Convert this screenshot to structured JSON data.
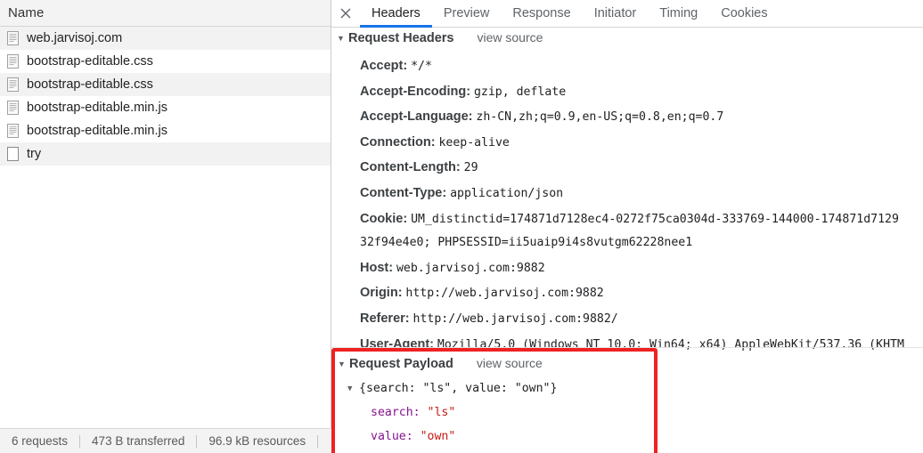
{
  "left_panel": {
    "column_header": "Name",
    "requests": [
      {
        "name": "web.jarvisoj.com",
        "icon": "document-icon"
      },
      {
        "name": "bootstrap-editable.css",
        "icon": "document-icon"
      },
      {
        "name": "bootstrap-editable.css",
        "icon": "document-icon"
      },
      {
        "name": "bootstrap-editable.min.js",
        "icon": "document-icon"
      },
      {
        "name": "bootstrap-editable.min.js",
        "icon": "document-icon"
      },
      {
        "name": "try",
        "icon": "blank-document-icon"
      }
    ],
    "status_bar": {
      "requests": "6 requests",
      "transferred": "473 B transferred",
      "resources": "96.9 kB resources"
    }
  },
  "right_panel": {
    "close_icon": "close-icon",
    "tabs": [
      {
        "label": "Headers",
        "active": true
      },
      {
        "label": "Preview",
        "active": false
      },
      {
        "label": "Response",
        "active": false
      },
      {
        "label": "Initiator",
        "active": false
      },
      {
        "label": "Timing",
        "active": false
      },
      {
        "label": "Cookies",
        "active": false
      }
    ],
    "request_headers": {
      "title": "Request Headers",
      "view_source": "view source",
      "twisty": "▼",
      "items": [
        {
          "name": "Accept:",
          "value": "*/*"
        },
        {
          "name": "Accept-Encoding:",
          "value": "gzip, deflate"
        },
        {
          "name": "Accept-Language:",
          "value": "zh-CN,zh;q=0.9,en-US;q=0.8,en;q=0.7"
        },
        {
          "name": "Connection:",
          "value": "keep-alive"
        },
        {
          "name": "Content-Length:",
          "value": "29"
        },
        {
          "name": "Content-Type:",
          "value": "application/json"
        },
        {
          "name": "Cookie:",
          "value": "UM_distinctid=174871d7128ec4-0272f75ca0304d-333769-144000-174871d7129"
        },
        {
          "name": "",
          "value": "32f94e4e0; PHPSESSID=ii5uaip9i4s8vutgm62228nee1",
          "continuation": true
        },
        {
          "name": "Host:",
          "value": "web.jarvisoj.com:9882"
        },
        {
          "name": "Origin:",
          "value": "http://web.jarvisoj.com:9882"
        },
        {
          "name": "Referer:",
          "value": "http://web.jarvisoj.com:9882/"
        },
        {
          "name": "User-Agent:",
          "value": "Mozilla/5.0 (Windows NT 10.0; Win64; x64) AppleWebKit/537.36 (KHTM"
        }
      ]
    },
    "request_payload": {
      "title": "Request Payload",
      "view_source": "view source",
      "twisty": "▼",
      "root_line": {
        "twisty": "▼",
        "text": "{search: \"ls\", value: \"own\"}",
        "open_brace": "{",
        "key1": "search:",
        "val1": "\"ls\"",
        "comma": ",",
        "key2": "value:",
        "val2": "\"own\"",
        "close_brace": "}"
      },
      "entries": [
        {
          "key": "search:",
          "value": "\"ls\""
        },
        {
          "key": "value:",
          "value": "\"own\""
        }
      ]
    },
    "highlight_color": "#ee2222"
  }
}
